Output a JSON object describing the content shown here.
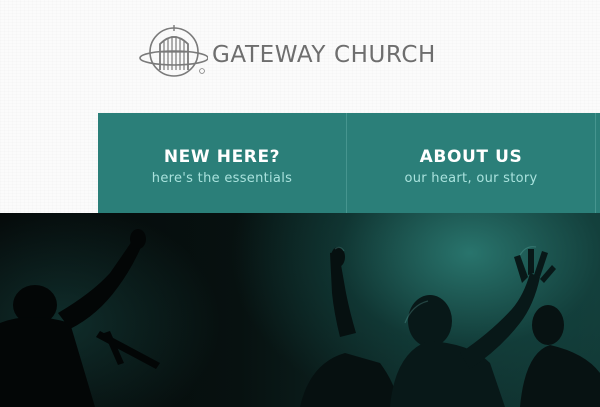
{
  "brand": {
    "name": "GATEWAY CHURCH",
    "logo_icon": "gate-globe-logo"
  },
  "nav": {
    "items": [
      {
        "title": "NEW HERE?",
        "subtitle": "here's the essentials"
      },
      {
        "title": "ABOUT US",
        "subtitle": "our heart, our story"
      }
    ]
  },
  "hero": {
    "image": "worship-crowd-raised-hands-photo"
  },
  "colors": {
    "nav_bg": "#2b7f79",
    "nav_title": "#ffffff",
    "nav_subtitle": "#a9e2dd",
    "brand_text": "#6e6e6e"
  }
}
